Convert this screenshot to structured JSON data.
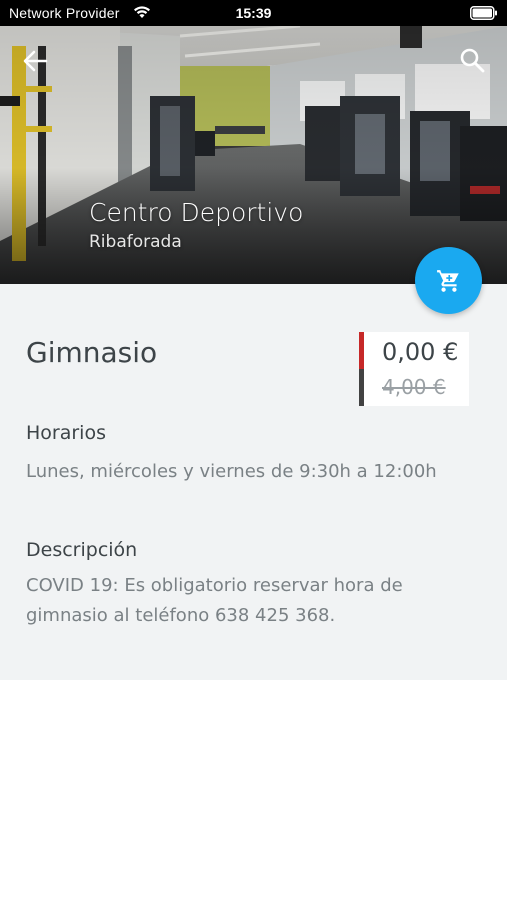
{
  "status_bar": {
    "carrier": "Network Provider",
    "time": "15:39"
  },
  "header": {
    "title": "Centro Deportivo",
    "subtitle": "Ribaforada",
    "back_icon": "arrow-left-icon",
    "search_icon": "search-icon"
  },
  "cart_button": {
    "icon": "cart-icon",
    "color": "#1aa9f0"
  },
  "activity": {
    "name": "Gimnasio",
    "price_current": "0,00 €",
    "price_original": "4,00 €"
  },
  "schedule": {
    "heading": "Horarios",
    "text": "Lunes, miércoles y viernes de 9:30h a 12:00h"
  },
  "description": {
    "heading": "Descripción",
    "text": "COVID 19: Es obligatorio reservar hora de gimnasio al teléfono 638 425 368."
  },
  "colors": {
    "accent": "#1aa9f0",
    "price_bar_current": "#c62828",
    "price_bar_original": "#424242"
  }
}
